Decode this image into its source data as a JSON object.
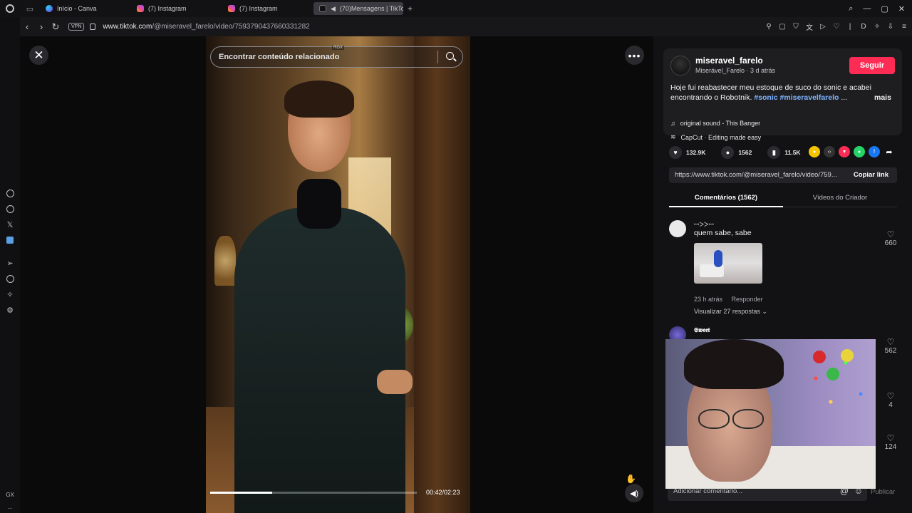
{
  "browser": {
    "tabs": [
      {
        "label": "Início - Canva",
        "favicon": "canva-icon"
      },
      {
        "label": "(7) Instagram",
        "favicon": "instagram-icon"
      },
      {
        "label": "(7) Instagram",
        "favicon": "instagram-icon"
      },
      {
        "label": "(70)Mensagens | TikTo",
        "favicon": "tiktok-icon",
        "active": true
      }
    ],
    "vpn_label": "VPN",
    "url_host": "www.tiktok.com",
    "url_path": "/@miseravel_farelo/video/7593790437660331282",
    "sidebar_bottom_label": "GX",
    "sidebar_dots": "..."
  },
  "video": {
    "search_placeholder": "Encontrar conteúdo relacionado",
    "overlay_badge": "RGX",
    "time": "00:42/02:23",
    "progress": 0.3
  },
  "post": {
    "username": "miseravel_farelo",
    "display_name": "Miserável_Farelo",
    "posted": "3 d atrás",
    "follow_label": "Seguir",
    "caption": "Hoje fui reabastecer meu estoque de suco do sonic e acabei encontrando o Robotnik. ",
    "tag1": "#sonic",
    "tag2": "#miseravelfarelo",
    "ellipsis": "...",
    "more_label": "mais",
    "sound": "original sound - This Banger",
    "capcut": "CapCut · Editing made easy",
    "likes": "132.9K",
    "comments": "1562",
    "saves": "11.5K",
    "link": "https://www.tiktok.com/@miseravel_farelo/video/759...",
    "copy_link": "Copiar link"
  },
  "panel_tabs": {
    "comments": "Comentários (1562)",
    "creator_videos": "Vídeos do Criador"
  },
  "comments": [
    {
      "name": "ꟷᐳᐳꟷ",
      "text": "quem sabe, sabe",
      "likes": "660",
      "time": "23 h atrás",
      "reply": "Responder",
      "view_replies": "Visualizar 27 respostas ⌄"
    },
    {
      "name": "𝕾𝖜𝖊𝖊𝖙",
      "likes": "562"
    }
  ],
  "extra_likes": [
    "4",
    "124"
  ],
  "composer": {
    "placeholder": "Adicionar comentário...",
    "publish": "Publicar",
    "at": "@",
    "emoji": "☺"
  },
  "colors": {
    "follow": "#fe2c55",
    "hashtag": "#7fb4ff",
    "panel_bg": "#121214"
  }
}
